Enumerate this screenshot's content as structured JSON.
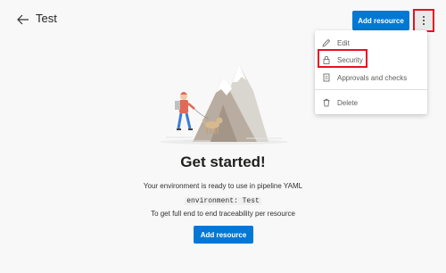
{
  "header": {
    "title": "Test",
    "add_resource_label": "Add resource"
  },
  "menu": {
    "items": [
      {
        "label": "Edit",
        "icon": "pencil-icon"
      },
      {
        "label": "Security",
        "icon": "lock-icon"
      },
      {
        "label": "Approvals and checks",
        "icon": "document-icon"
      },
      {
        "label": "Delete",
        "icon": "trash-icon"
      }
    ]
  },
  "empty_state": {
    "heading": "Get started!",
    "description": "Your environment is ready to use in pipeline YAML",
    "code": "environment: Test",
    "traceability": "To get full end to end traceability per resource",
    "button_label": "Add resource"
  },
  "colors": {
    "accent": "#0078d4",
    "highlight": "#e81123"
  }
}
